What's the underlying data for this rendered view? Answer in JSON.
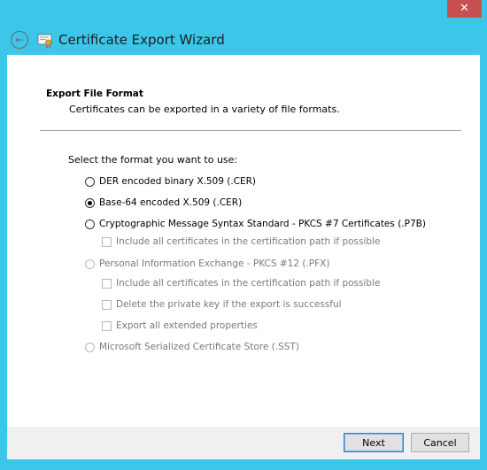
{
  "window": {
    "close_glyph": "✕"
  },
  "header": {
    "back_glyph": "←",
    "title": "Certificate Export Wizard"
  },
  "page": {
    "section_title": "Export File Format",
    "section_subtitle": "Certificates can be exported in a variety of file formats.",
    "prompt": "Select the format you want to use:"
  },
  "options": {
    "der": {
      "label": "DER encoded binary X.509 (.CER)",
      "selected": false,
      "enabled": true
    },
    "base64": {
      "label": "Base-64 encoded X.509 (.CER)",
      "selected": true,
      "enabled": true
    },
    "pkcs7": {
      "label": "Cryptographic Message Syntax Standard - PKCS #7 Certificates (.P7B)",
      "selected": false,
      "enabled": true
    },
    "pkcs7_include": {
      "label": "Include all certificates in the certification path if possible",
      "checked": false,
      "enabled": false
    },
    "pfx": {
      "label": "Personal Information Exchange - PKCS #12 (.PFX)",
      "selected": false,
      "enabled": false
    },
    "pfx_include": {
      "label": "Include all certificates in the certification path if possible",
      "checked": false,
      "enabled": false
    },
    "pfx_delete_key": {
      "label": "Delete the private key if the export is successful",
      "checked": false,
      "enabled": false
    },
    "pfx_extended": {
      "label": "Export all extended properties",
      "checked": false,
      "enabled": false
    },
    "sst": {
      "label": "Microsoft Serialized Certificate Store (.SST)",
      "selected": false,
      "enabled": false
    }
  },
  "footer": {
    "next_label": "Next",
    "cancel_label": "Cancel"
  },
  "colors": {
    "frame": "#3cc6ea",
    "close": "#c75050",
    "footer": "#f0f0f0"
  }
}
